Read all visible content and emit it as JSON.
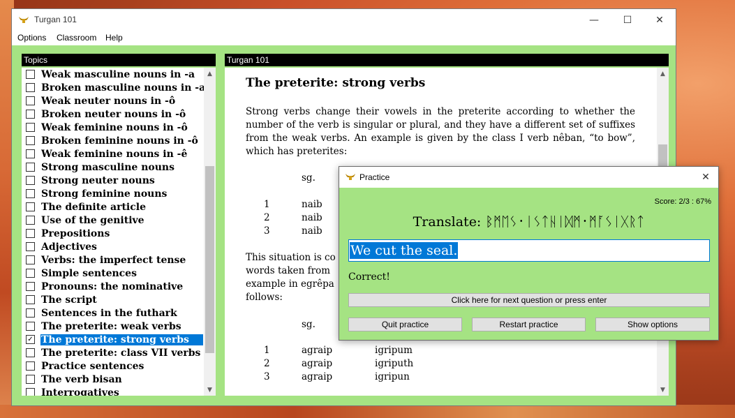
{
  "main_window": {
    "title": "Turgan 101",
    "controls": {
      "minimize": "—",
      "maximize": "☐",
      "close": "✕"
    }
  },
  "menu": [
    "Options",
    "Classroom",
    "Help"
  ],
  "topics": {
    "header": "Topics",
    "items": [
      {
        "label": "Weak masculine nouns in -a",
        "checked": false
      },
      {
        "label": "Broken masculine nouns in -a",
        "checked": false
      },
      {
        "label": "Weak neuter nouns in -ô",
        "checked": false
      },
      {
        "label": "Broken neuter nouns in -ô",
        "checked": false
      },
      {
        "label": "Weak feminine nouns in -ô",
        "checked": false
      },
      {
        "label": "Broken feminine nouns in -ô",
        "checked": false
      },
      {
        "label": "Weak feminine nouns in -ê",
        "checked": false
      },
      {
        "label": "Strong masculine nouns",
        "checked": false
      },
      {
        "label": "Strong neuter nouns",
        "checked": false
      },
      {
        "label": "Strong feminine nouns",
        "checked": false
      },
      {
        "label": "The definite article",
        "checked": false
      },
      {
        "label": "Use of the genitive",
        "checked": false
      },
      {
        "label": "Prepositions",
        "checked": false
      },
      {
        "label": "Adjectives",
        "checked": false
      },
      {
        "label": "Verbs: the imperfect tense",
        "checked": false
      },
      {
        "label": "Simple sentences",
        "checked": false
      },
      {
        "label": "Pronouns: the nominative",
        "checked": false
      },
      {
        "label": "The script",
        "checked": false
      },
      {
        "label": "Sentences in the futhark",
        "checked": false
      },
      {
        "label": "The preterite: weak verbs",
        "checked": false
      },
      {
        "label": "The preterite: strong verbs",
        "checked": true,
        "selected": true
      },
      {
        "label": "The preterite: class VII verbs",
        "checked": false
      },
      {
        "label": "Practice sentences",
        "checked": false
      },
      {
        "label": "The verb bisan",
        "checked": false
      },
      {
        "label": "Interrogatives",
        "checked": false
      }
    ]
  },
  "content": {
    "header": "Turgan 101",
    "title": "The preterite: strong verbs",
    "para1": "Strong verbs change their vowels in the preterite according to whether the number of the verb is singular or plural, and they have a different set of suffixes from the weak verbs. An example is given by the class I verb nêban, “to bow”, which has preterites:",
    "table1": {
      "header": "sg.",
      "rows": [
        {
          "num": "1",
          "sg": "naib"
        },
        {
          "num": "2",
          "sg": "naib"
        },
        {
          "num": "3",
          "sg": "naib"
        }
      ]
    },
    "para2_lines": [
      "This situation is co",
      "words taken from",
      "example in egrêpa",
      "follows:"
    ],
    "table2": {
      "header": "sg.",
      "rows": [
        {
          "num": "1",
          "sg": "agraip",
          "pl": "igripum"
        },
        {
          "num": "2",
          "sg": "agraip",
          "pl": "igriputh"
        },
        {
          "num": "3",
          "sg": "agraip",
          "pl": "igripun"
        }
      ]
    }
  },
  "practice": {
    "title": "Practice",
    "close": "✕",
    "score_label": "Score:",
    "score_value": "2/3 : 67%",
    "translate_label": "Translate:",
    "translate_runes": "ᛒᛗᛖᛊ᛫ᛁᛊᛏᚺᛁᛞᛗ᛫ᛗᚪᛊᛁᚷᚱᛏ",
    "answer": "We cut the seal.",
    "feedback": "Correct!",
    "next_button": "Click here for next question or press enter",
    "quit_button": "Quit practice",
    "restart_button": "Restart practice",
    "options_button": "Show options"
  }
}
